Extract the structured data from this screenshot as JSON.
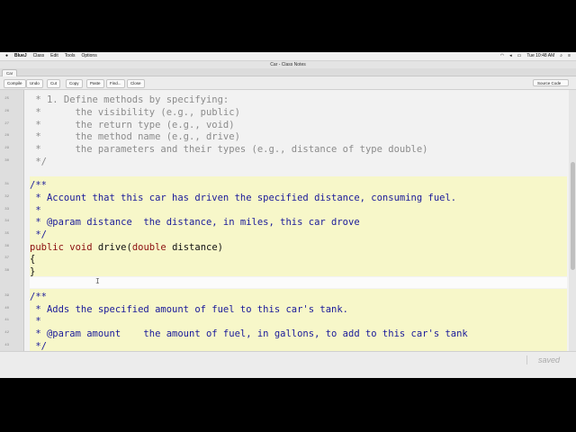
{
  "menubar": {
    "apple": "",
    "app": "BlueJ",
    "items": [
      "Class",
      "Edit",
      "Tools",
      "Options"
    ],
    "clock": "Tue 10:48 AM"
  },
  "window": {
    "title": "Car - Class Notes"
  },
  "tab": {
    "label": "Car"
  },
  "toolbar": {
    "buttons": [
      "Compile",
      "Undo",
      "Cut",
      "Copy",
      "Paste",
      "Find...",
      "Close"
    ],
    "view_select": "Source Code"
  },
  "code": {
    "lines": [
      {
        "n": "25",
        "text": " * 1. Define methods by specifying:"
      },
      {
        "n": "26",
        "text": " *      the visibility (e.g., public)"
      },
      {
        "n": "27",
        "text": " *      the return type (e.g., void)"
      },
      {
        "n": "28",
        "text": " *      the method name (e.g., drive)"
      },
      {
        "n": "29",
        "text": " *      the parameters and their types (e.g., distance of type double)"
      },
      {
        "n": "30",
        "text": " */"
      },
      {
        "n": "31",
        "text": "/**"
      },
      {
        "n": "32",
        "text": " * Account that this car has driven the specified distance, consuming fuel."
      },
      {
        "n": "33",
        "text": " *"
      },
      {
        "n": "34",
        "text": " * @param distance  the distance, in miles, this car drove"
      },
      {
        "n": "35",
        "text": " */"
      },
      {
        "n": "36",
        "kw1": "public",
        "kw2": "void",
        "name": " drive(",
        "kw3": "double",
        "rest": " distance)"
      },
      {
        "n": "37",
        "text": "{"
      },
      {
        "n": "38",
        "text": "}"
      },
      {
        "n": "39",
        "text": "/**"
      },
      {
        "n": "40",
        "text": " * Adds the specified amount of fuel to this car's tank."
      },
      {
        "n": "41",
        "text": " *"
      },
      {
        "n": "42",
        "text": " * @param amount    the amount of fuel, in gallons, to add to this car's tank"
      },
      {
        "n": "43",
        "text": " */"
      }
    ]
  },
  "status": {
    "saved": "saved"
  }
}
